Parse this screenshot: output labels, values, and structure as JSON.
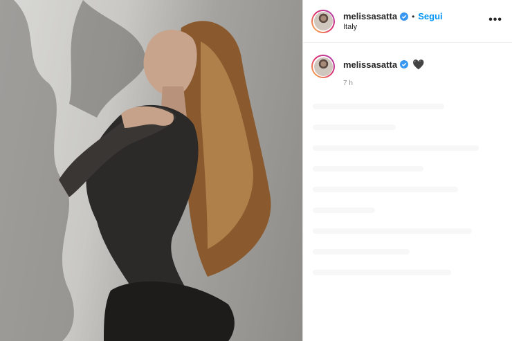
{
  "post": {
    "username": "melissasatta",
    "follow_label": "Segui",
    "dot": "•",
    "location": "Italy",
    "more_label": "•••",
    "caption_username": "melissasatta",
    "caption_emoji": "🖤",
    "time": "7 h"
  },
  "colors": {
    "accent": "#0095f6",
    "verified": "#3897f0"
  },
  "icons": {
    "verified": "verified-badge-icon",
    "more": "more-options-icon"
  }
}
